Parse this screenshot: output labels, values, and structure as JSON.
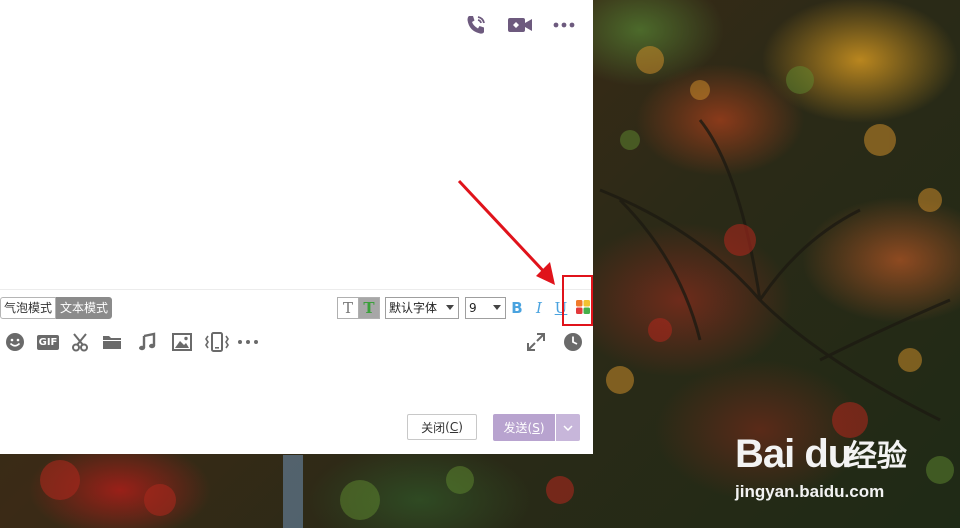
{
  "mode_switch": {
    "bubble_label": "气泡模式",
    "text_label": "文本模式"
  },
  "format": {
    "plain_text_glyph": "T",
    "color_text_glyph": "T",
    "font_family": "默认字体",
    "font_size": "9",
    "bold": "B",
    "italic": "I",
    "underline": "U"
  },
  "toolbar": {
    "gif_label": "GIF"
  },
  "buttons": {
    "close_label": "关闭",
    "close_key": "C",
    "send_label": "发送",
    "send_key": "S"
  },
  "colors": {
    "send_bg": "#b8a3cf",
    "icon": "#6d5a7e",
    "highlight": "#e0131b"
  },
  "watermark": {
    "logo_text": "Bai du",
    "logo_cn": "经验",
    "url": "jingyan.baidu.com"
  }
}
